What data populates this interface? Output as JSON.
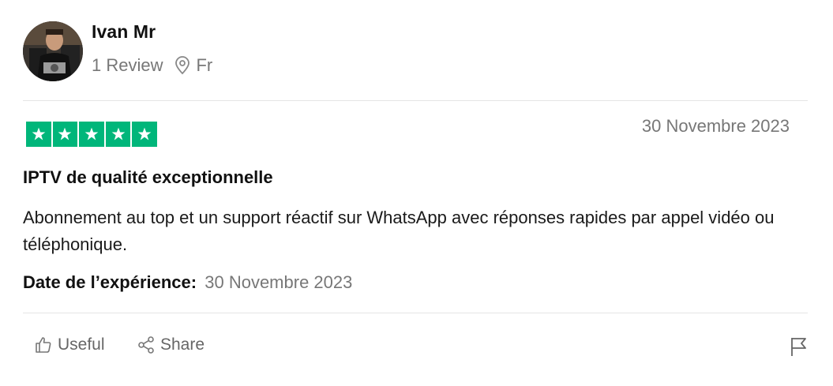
{
  "reviewer": {
    "name": "Ivan Mr",
    "review_count": "1 Review",
    "location": "Fr"
  },
  "review": {
    "rating": 5,
    "rating_color": "#00b67a",
    "date": "30 Novembre 2023",
    "title": "IPTV de qualité exceptionnelle",
    "body": "Abonnement au top et un support réactif sur WhatsApp avec réponses rapides par appel vidéo ou téléphonique.",
    "experience_label": "Date de l’expérience:",
    "experience_value": "30 Novembre 2023"
  },
  "actions": {
    "useful_label": "Useful",
    "share_label": "Share"
  },
  "icons": {
    "location": "location-pin-icon",
    "useful": "thumbs-up-icon",
    "share": "share-icon",
    "flag": "flag-icon",
    "star": "star-icon"
  }
}
